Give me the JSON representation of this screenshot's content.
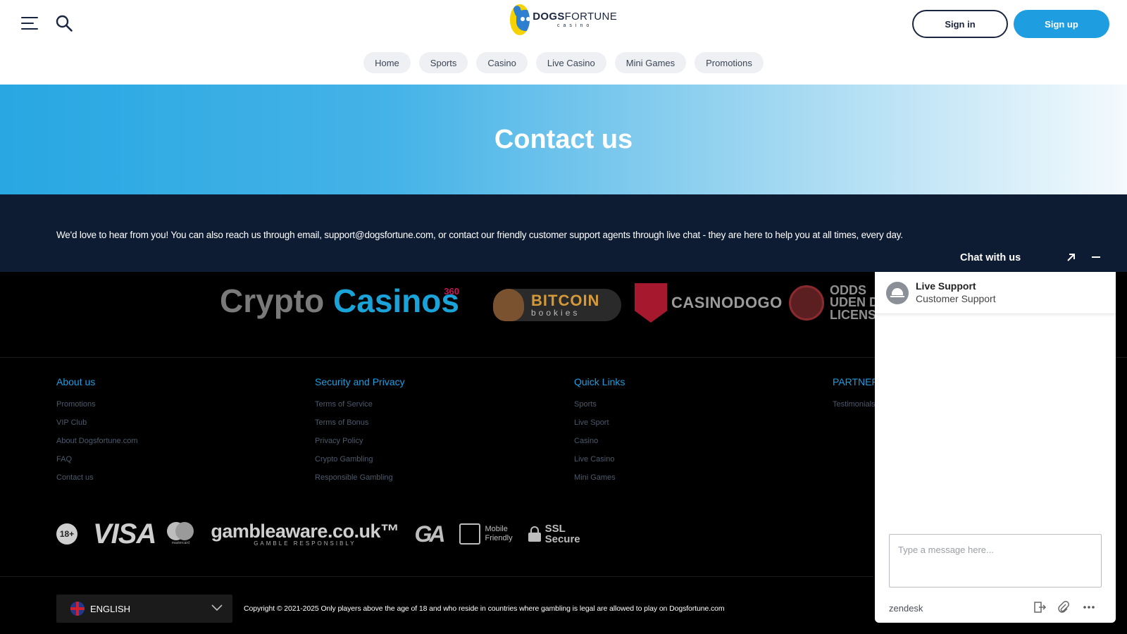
{
  "brand": {
    "name_bold": "DOGS",
    "name_light": "FORTUNE",
    "sub": "casino"
  },
  "header": {
    "sign_in": "Sign in",
    "sign_up": "Sign up",
    "nav": [
      "Home",
      "Sports",
      "Casino",
      "Live Casino",
      "Mini Games",
      "Promotions"
    ]
  },
  "hero": {
    "title": "Contact us"
  },
  "intro": {
    "text": "We'd love to hear from you! You can also reach us through email, support@dogsfortune.com, or contact our friendly customer support agents through live chat - they are here to help you at all times, every day."
  },
  "partners": {
    "crypto": {
      "word1": "Crypto",
      "word2": "Casinos",
      "sup": "360"
    },
    "bitcoin": {
      "line1": "BITCOIN",
      "line2": "bookies"
    },
    "dogo": "CASINODOGO",
    "odds": [
      "ODDS",
      "UDEN D",
      "LICENS"
    ]
  },
  "footer": {
    "columns": [
      {
        "title": "About us",
        "links": [
          "Promotions",
          "VIP Club",
          "About Dogsfortune.com",
          "FAQ",
          "Contact us"
        ]
      },
      {
        "title": "Security and Privacy",
        "links": [
          "Terms of Service",
          "Terms of Bonus",
          "Privacy Policy",
          "Crypto Gambling",
          "Responsible Gambling"
        ]
      },
      {
        "title": "Quick Links",
        "links": [
          "Sports",
          "Live Sport",
          "Casino",
          "Live Casino",
          "Mini Games"
        ]
      },
      {
        "title": "PARTNERS",
        "links": [
          "Testimonials"
        ]
      }
    ],
    "badges": {
      "age": "18+",
      "visa": "VISA",
      "mastercard": "mastercard",
      "gambleaware": "gambleaware.co.uk™",
      "gambleaware_sub": "GAMBLE RESPONSIBLY",
      "ga": "GA",
      "mobile": [
        "Mobile",
        "Friendly"
      ],
      "ssl": [
        "SSL",
        "Secure"
      ]
    },
    "language": "ENGLISH",
    "copyright": "Copyright © 2021-2025 Only players above the age of 18 and who reside in countries where gambling is legal are allowed to play on Dogsfortune.com"
  },
  "chat": {
    "title": "Chat with us",
    "agent_name": "Live Support",
    "agent_role": "Customer Support",
    "placeholder": "Type a message here...",
    "provider": "zendesk"
  },
  "colors": {
    "accent": "#1e9de0",
    "navy": "#0d1c33",
    "footer_link": "#4d5a6b"
  }
}
